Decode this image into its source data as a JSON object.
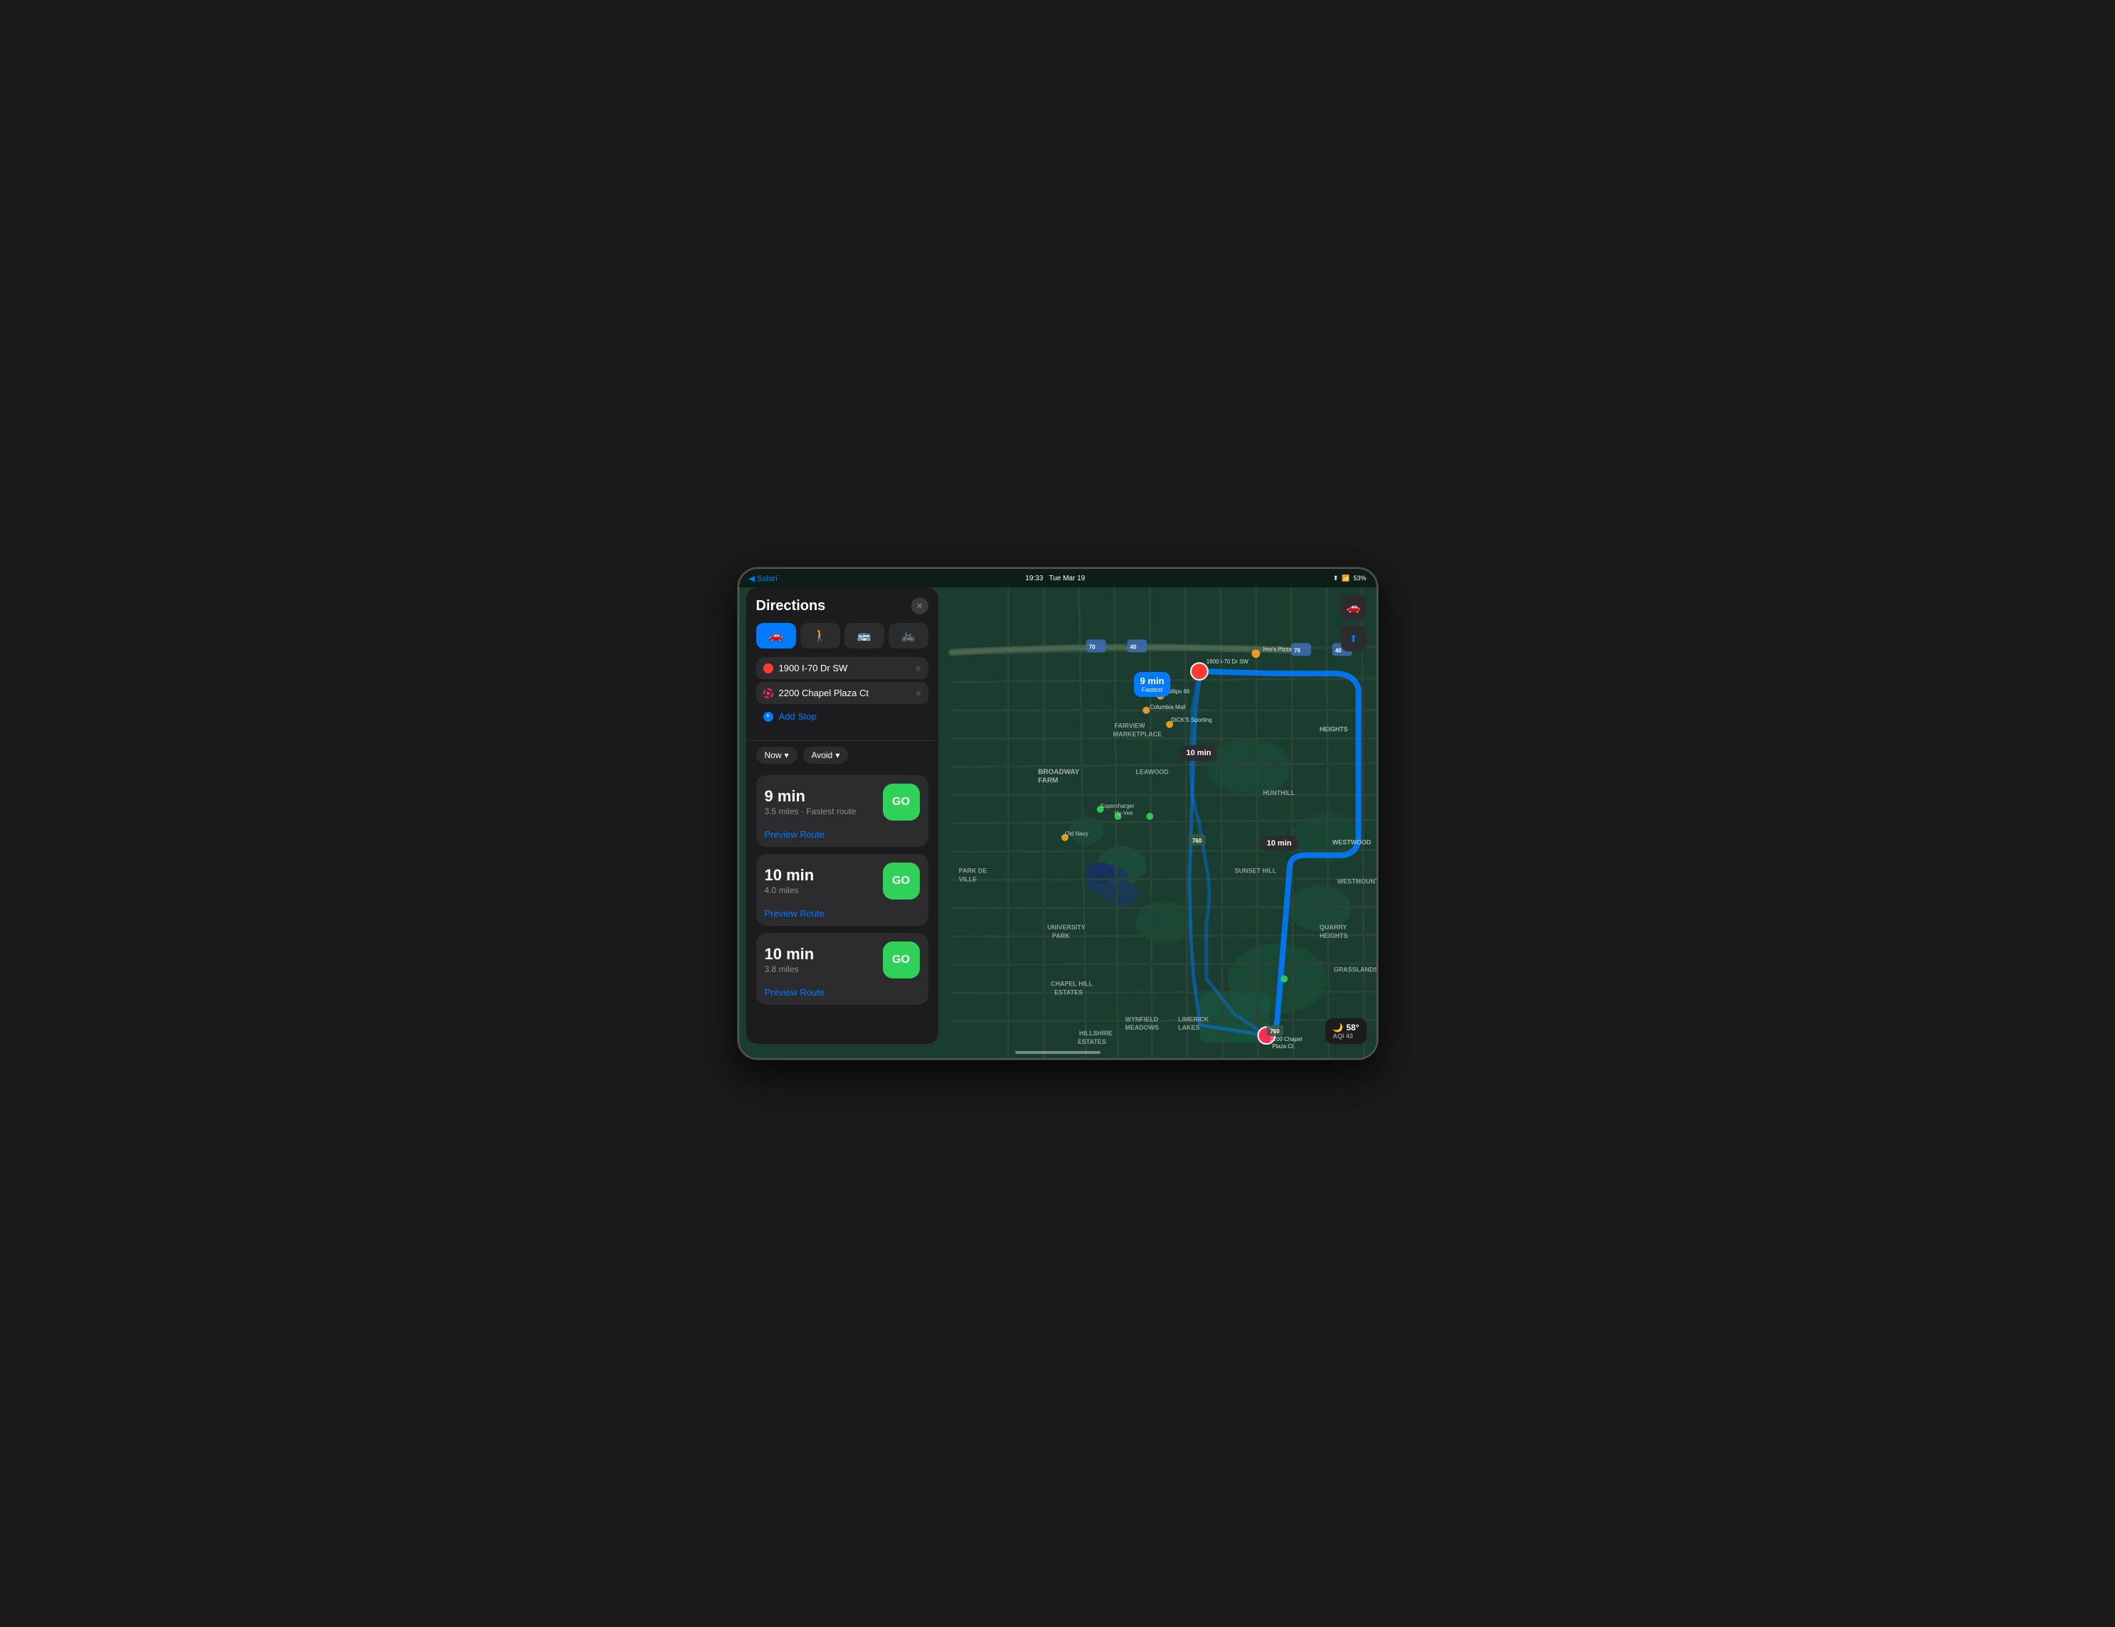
{
  "status_bar": {
    "back_label": "◀ Safari",
    "time": "19:33",
    "date": "Tue Mar 19",
    "battery": "53%",
    "signal_icon": "wifi"
  },
  "sidebar": {
    "title": "Directions",
    "close_label": "✕",
    "transport_modes": [
      {
        "id": "car",
        "icon": "🚗",
        "active": true
      },
      {
        "id": "walk",
        "icon": "🚶",
        "active": false
      },
      {
        "id": "transit",
        "icon": "🚌",
        "active": false
      },
      {
        "id": "bike",
        "icon": "🚲",
        "active": false
      }
    ],
    "origin": "1900 I-70 Dr SW",
    "destination": "2200 Chapel Plaza Ct",
    "add_stop_label": "Add Stop",
    "options": [
      {
        "id": "time",
        "label": "Now",
        "has_chevron": true
      },
      {
        "id": "avoid",
        "label": "Avoid",
        "has_chevron": true
      }
    ],
    "routes": [
      {
        "id": "route1",
        "time": "9 min",
        "distance": "3.5 miles",
        "tag": "Fastest route",
        "go_label": "GO",
        "preview_label": "Preview Route"
      },
      {
        "id": "route2",
        "time": "10 min",
        "distance": "4.0 miles",
        "tag": "",
        "go_label": "GO",
        "preview_label": "Preview Route"
      },
      {
        "id": "route3",
        "time": "10 min",
        "distance": "3.8 miles",
        "tag": "",
        "go_label": "GO",
        "preview_label": "Preview Route"
      }
    ]
  },
  "map": {
    "callouts": [
      {
        "id": "fastest",
        "label": "9 min",
        "sub": "Fastest",
        "style": "fastest"
      },
      {
        "id": "mid",
        "label": "10 min",
        "sub": "",
        "style": "dark"
      },
      {
        "id": "right",
        "label": "10 min",
        "sub": "",
        "style": "dark"
      }
    ],
    "pins": [
      {
        "id": "origin",
        "label": "1900 I-70 Dr SW",
        "color": "red"
      },
      {
        "id": "destination",
        "label": "2200 Chapel Plaza Ct",
        "color": "pink"
      }
    ],
    "weather": {
      "temp": "58°",
      "moon_icon": "🌙",
      "aqi_label": "AQI 43"
    },
    "controls": [
      {
        "id": "car-mode",
        "icon": "🚗"
      },
      {
        "id": "location",
        "icon": "⬆"
      }
    ]
  }
}
